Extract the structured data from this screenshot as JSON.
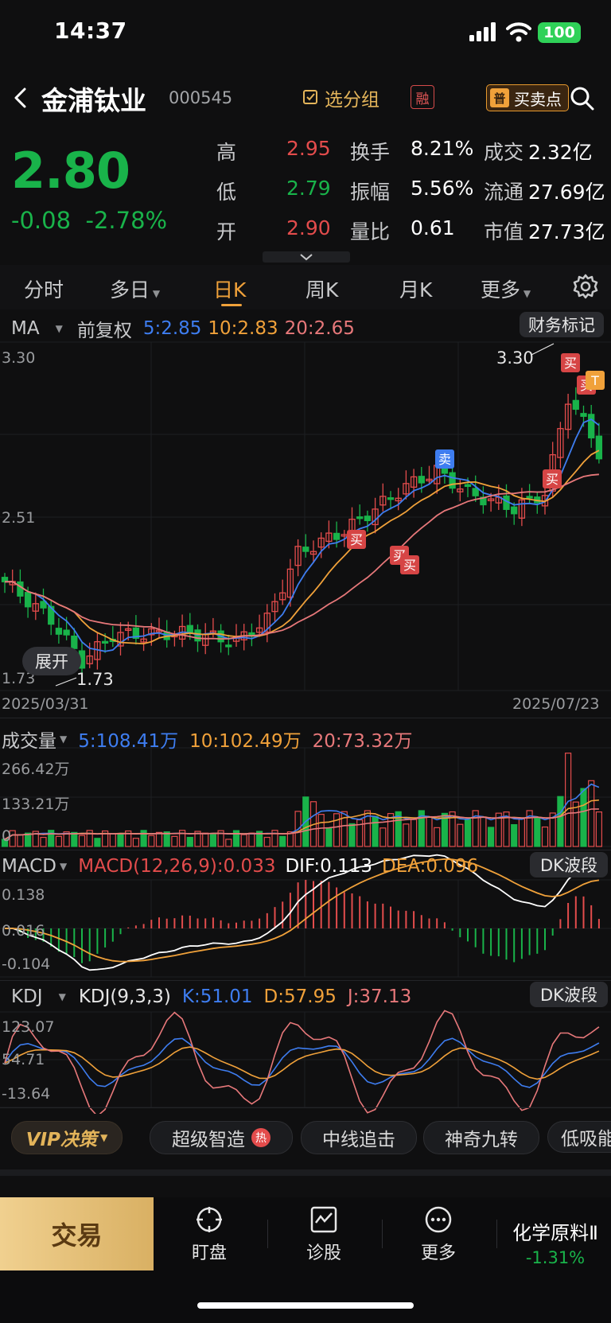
{
  "status": {
    "time": "14:37",
    "battery": "100"
  },
  "header": {
    "name": "金浦钛业",
    "code": "000545",
    "group_btn": "选分组",
    "rong": "融",
    "buysell_badge": "普",
    "buysell": "买卖点"
  },
  "quote": {
    "price": "2.80",
    "change": "-0.08",
    "change_pct": "-2.78%",
    "stats": [
      {
        "label": "高",
        "value": "2.95",
        "color": "red"
      },
      {
        "label": "换手",
        "value": "8.21%",
        "color": "white"
      },
      {
        "label": "成交",
        "value": "2.32亿",
        "color": "white"
      },
      {
        "label": "低",
        "value": "2.79",
        "color": "green"
      },
      {
        "label": "振幅",
        "value": "5.56%",
        "color": "white"
      },
      {
        "label": "流通",
        "value": "27.69亿",
        "color": "white"
      },
      {
        "label": "开",
        "value": "2.90",
        "color": "red"
      },
      {
        "label": "量比",
        "value": "0.61",
        "color": "white"
      },
      {
        "label": "市值",
        "value": "27.73亿",
        "color": "white"
      }
    ]
  },
  "tabs": [
    "分时",
    "多日",
    "日K",
    "周K",
    "月K",
    "更多"
  ],
  "kline": {
    "indicator": "MA",
    "adjust": "前复权",
    "ma5": "5:2.85",
    "ma10": "10:2.83",
    "ma20": "20:2.65",
    "finance_btn": "财务标记",
    "y_top": "3.30",
    "y_mid": "2.51",
    "y_bottom": "1.73",
    "high_mark": "3.30",
    "low_mark": "1.73",
    "date_start": "2025/03/31",
    "date_end": "2025/07/23",
    "expand": "展开",
    "signal_buy": "买",
    "signal_sell": "卖",
    "signal_t": "T"
  },
  "volume": {
    "label": "成交量",
    "ma5": "5:108.41万",
    "ma10": "10:102.49万",
    "ma20": "20:73.32万",
    "y_top": "266.42万",
    "y_mid": "133.21万",
    "y_bottom": "0"
  },
  "macd": {
    "label": "MACD",
    "params": "MACD(12,26,9):0.033",
    "dif": "DIF:0.113",
    "dea": "DEA:0.096",
    "btn": "DK波段",
    "y_top": "0.138",
    "y_mid": "0.016",
    "y_bottom": "-0.104"
  },
  "kdj": {
    "label": "KDJ",
    "params": "KDJ(9,3,3)",
    "k": "K:51.01",
    "d": "D:57.95",
    "j": "J:37.13",
    "btn": "DK波段",
    "y_top": "123.07",
    "y_mid": "54.71",
    "y_bottom": "-13.64"
  },
  "tools": {
    "vip": "VIP决策",
    "items": [
      "超级智造",
      "中线追击",
      "神奇九转",
      "低吸能"
    ],
    "hot": "热"
  },
  "bottom": {
    "trade": "交易",
    "watch": "盯盘",
    "diagnose": "诊股",
    "more": "更多",
    "sector": "化学原料Ⅱ",
    "sector_chg": "-1.31%"
  },
  "colors": {
    "up": "#e34c4c",
    "down": "#19b34a",
    "ma5": "#3e7df0",
    "ma10": "#f0a13a",
    "ma20": "#e7787a",
    "accent": "#f0a13a"
  }
}
